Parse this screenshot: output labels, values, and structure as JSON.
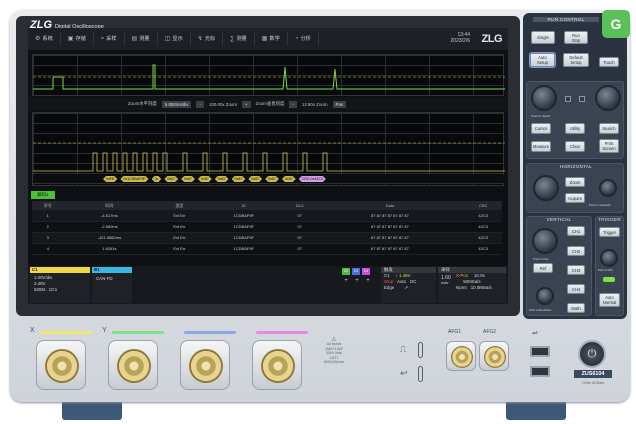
{
  "brand": {
    "logo": "ZLG",
    "subtitle": "Digital Oscilloscope"
  },
  "toolbar": {
    "items": [
      {
        "icon": "gear-icon",
        "glyph": "⚙",
        "label": "系统"
      },
      {
        "icon": "save-icon",
        "glyph": "▣",
        "label": "存储"
      },
      {
        "icon": "sample-icon",
        "glyph": "≈",
        "label": "采样"
      },
      {
        "icon": "measure-icon",
        "glyph": "▤",
        "label": "测量"
      },
      {
        "icon": "display-icon",
        "glyph": "◫",
        "label": "显示"
      },
      {
        "icon": "trigger-icon",
        "glyph": "↯",
        "label": "光标"
      },
      {
        "icon": "math-icon",
        "glyph": "∑",
        "label": "测量"
      },
      {
        "icon": "ref-icon",
        "glyph": "▦",
        "label": "数学"
      },
      {
        "icon": "analysis-icon",
        "glyph": "◔",
        "label": "分析"
      }
    ],
    "time": "13:44",
    "date": "2023/2/6",
    "logo": "ZLG"
  },
  "zoombar": {
    "label1": "Zoom水平刻度",
    "value1": "5.000ms/div",
    "label2": "100.00x Zoom",
    "label3": "Zoom垂直刻度",
    "value3": "12.80x Zoom",
    "btn": "Pos"
  },
  "decode": {
    "tag": "解码1",
    "frames": [
      "0xFE",
      "0x1CDBAF9F",
      "0x",
      "0x07",
      "0x87",
      "0x87",
      "0x87",
      "0x87",
      "0x87",
      "0x87",
      "0x87",
      "CRC:0x42C3"
    ]
  },
  "table": {
    "headers": [
      "序号",
      "时间",
      "类型",
      "ID",
      "DLC",
      "Data",
      "CRC"
    ],
    "rows": [
      [
        "1",
        "-4.517ms",
        "Ext Err",
        "1CDBAF9F",
        "07",
        "87 87 87 87 87 87 87",
        "42C3"
      ],
      [
        "2",
        "-2.669ms",
        "Ext Err",
        "1CDBAF9F",
        "07",
        "87 87 87 87 87 87 87",
        "42C3"
      ],
      [
        "3",
        "-421.5882ms",
        "Ext Err",
        "1CDBAF9F",
        "07",
        "87 87 87 87 87 87 87",
        "42C3"
      ],
      [
        "4",
        "1.6261s",
        "Ext Err",
        "1CDBAF9F",
        "07",
        "87 87 87 87 87 87 87",
        "42C3"
      ]
    ]
  },
  "status": {
    "ch1": {
      "label": "C1",
      "b1": "B1",
      "scale": "1.00V/div",
      "offset": "2.48V",
      "extra": "500M . 10:1",
      "bus": "CAN-FD"
    },
    "mathtags": [
      "C2",
      "C3",
      "C4"
    ],
    "trig": {
      "title": "触发",
      "ch": "C1",
      "level": "↑ 1.48V",
      "mode": "Auto",
      "coupling": "DC",
      "type": "Edge",
      "slope": "↗",
      "stop": "Stop"
    },
    "acq": {
      "title": "采样",
      "xpos": "X-Pos",
      "xval": "10.0s",
      "depth": "1.60",
      "unit": "s/div",
      "rate": "50MSa/s",
      "mode": "Norm",
      "pts": "10.0MSa/s"
    }
  },
  "front": {
    "channels": [
      {
        "label": "X",
        "color": "#f2e86a"
      },
      {
        "label": "Y",
        "color": "#7fe08a"
      },
      {
        "label": "",
        "color": "#8aa8e8"
      },
      {
        "label": "",
        "color": "#e48ae0"
      }
    ],
    "warning": [
      "All inputs",
      "1MΩ+13pF",
      "300V Max",
      "CAT I",
      "800V(Ω)max"
    ],
    "afg1": "AFG1",
    "afg2": "AFG2",
    "model": "ZUS6104",
    "model_sub": "1GHz 5GSa/s"
  },
  "panel": {
    "run_control": "RUN CONTROL",
    "single": "Single",
    "runstop": "Run\nStop",
    "autoset": "Auto\nSetup",
    "default": "Default\nSetup",
    "touch": "Touch",
    "cursor": "Cursor",
    "utility": "Utility",
    "search": "Search",
    "measure": "Measure",
    "clear": "Clear",
    "print": "Print\nScreen",
    "push_select": "Push to Select",
    "horizontal": "HORIZONTAL",
    "zoom": "Zoom",
    "acquire": "Acquire",
    "push_zoom": "Push to Zoom",
    "push_coarse": "Push to coarse/fall",
    "vertical": "VERTICAL",
    "trigger": "TRIGGER",
    "ch1": "CH1",
    "ch2": "CH2",
    "ch3": "CH3",
    "ch4": "CH4",
    "ref": "Ref",
    "math": "Math",
    "trigger_btn": "Trigger",
    "auto_normal": "Auto\nNormal",
    "push_fine": "Push to Fine",
    "push_zero": "Push to Zero/Reset",
    "push_50": "Push to 50%"
  }
}
